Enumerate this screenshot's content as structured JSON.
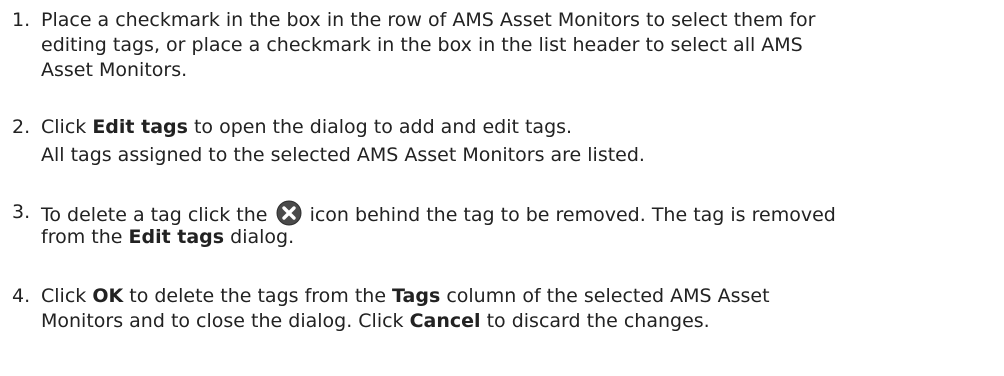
{
  "steps": [
    {
      "number": "1.",
      "lines": [
        "Place a checkmark in the box in the row of AMS Asset Monitors to select them for",
        "editing tags, or place a checkmark in the box in the list header to select all AMS",
        "Asset Monitors."
      ]
    },
    {
      "number": "2.",
      "prefix": "Click ",
      "bold": "Edit tags",
      "suffix": " to open the dialog to add and edit tags.",
      "result": "All tags assigned to the selected AMS Asset Monitors are listed."
    },
    {
      "number": "3.",
      "prefix": "To delete a tag click the ",
      "icon": "close-circle-icon",
      "middle": " icon behind the tag to be removed. The tag is removed",
      "line2_prefix": "from the ",
      "line2_bold": "Edit tags",
      "line2_suffix": " dialog."
    },
    {
      "number": "4.",
      "prefix": "Click ",
      "bold1": "OK",
      "mid": " to delete the tags from the ",
      "bold2": "Tags",
      "suffix": " column of the selected AMS Asset",
      "line2_prefix": "Monitors and to close the dialog. Click ",
      "line2_bold": "Cancel",
      "line2_suffix": " to discard the changes."
    }
  ],
  "colors": {
    "text": "#222222",
    "icon_fill": "#4a4a4a",
    "icon_mark": "#ffffff"
  }
}
